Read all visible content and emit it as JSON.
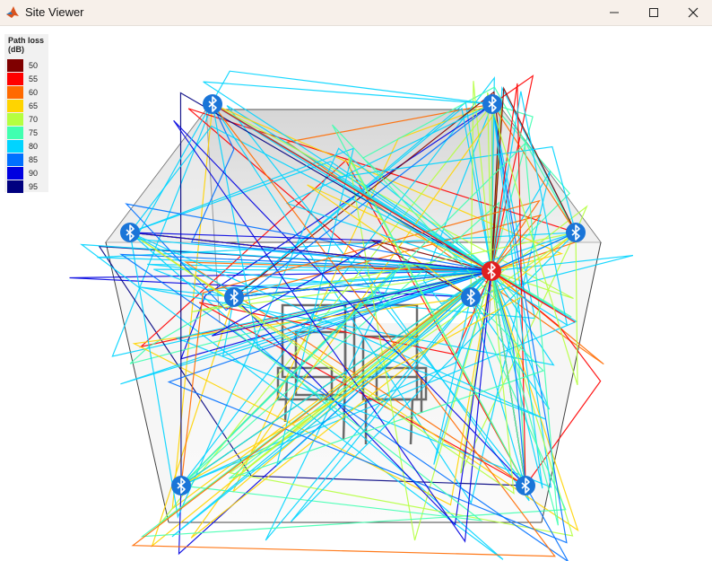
{
  "window": {
    "title": "Site Viewer",
    "controls": [
      "minimize",
      "maximize",
      "close"
    ]
  },
  "legend": {
    "title_line1": "Path loss",
    "title_line2": "(dB)",
    "entries": [
      {
        "label": "50",
        "color": "#7f0000"
      },
      {
        "label": "55",
        "color": "#ff0000"
      },
      {
        "label": "60",
        "color": "#ff6a00"
      },
      {
        "label": "65",
        "color": "#ffd400"
      },
      {
        "label": "70",
        "color": "#b5ff40"
      },
      {
        "label": "75",
        "color": "#40ffb0"
      },
      {
        "label": "80",
        "color": "#00d4ff"
      },
      {
        "label": "85",
        "color": "#0070ff"
      },
      {
        "label": "90",
        "color": "#0000e0"
      },
      {
        "label": "95",
        "color": "#00007f"
      }
    ]
  },
  "scene": {
    "transmitter_icon": "bluetooth-icon",
    "transmitter_color": "#e02020",
    "receiver_color": "#1a75d8",
    "receivers": 8
  }
}
